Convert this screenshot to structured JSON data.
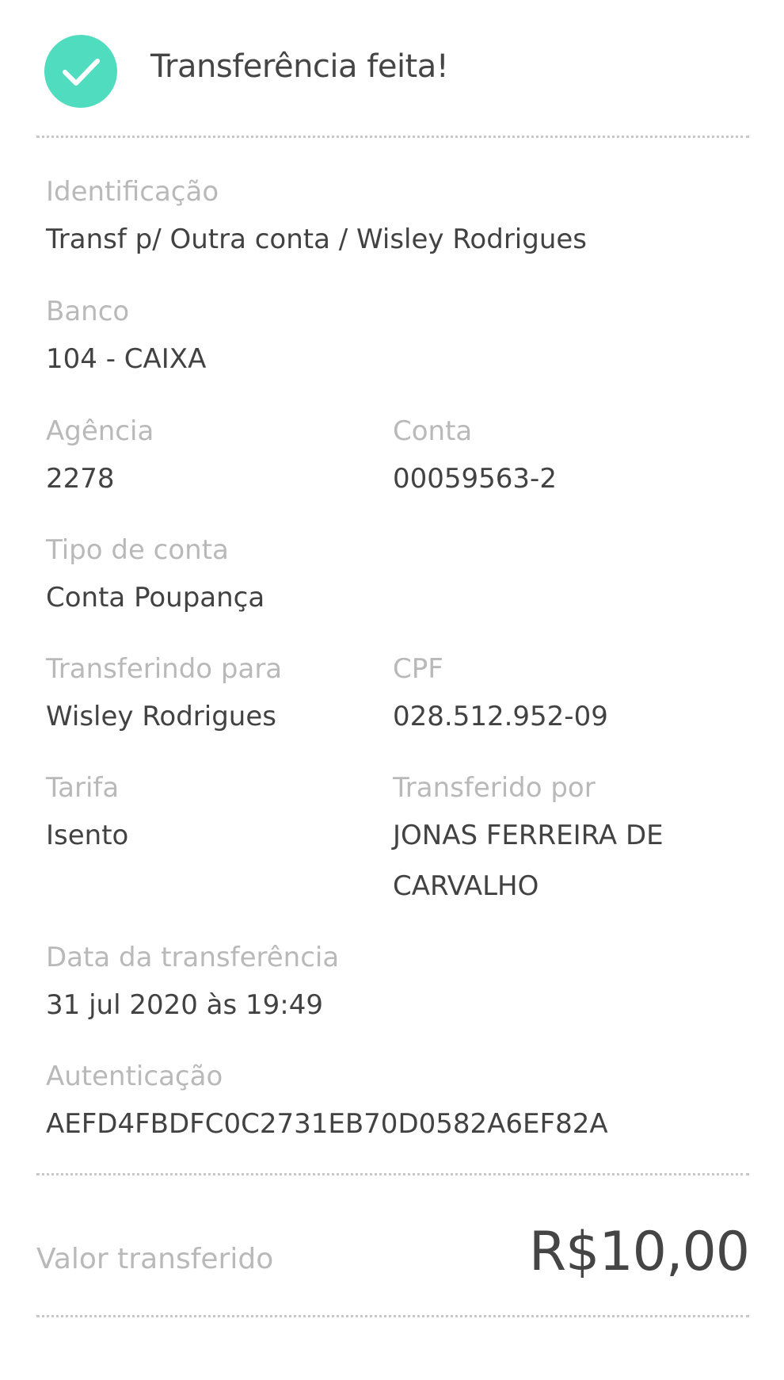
{
  "header": {
    "title": "Transferência feita!",
    "status_icon": "check-icon",
    "accent_color": "#4fdcbf"
  },
  "details": {
    "identificacao": {
      "label": "Identificação",
      "value": "Transf p/ Outra conta / Wisley Rodrigues"
    },
    "banco": {
      "label": "Banco",
      "value": "104 -  CAIXA"
    },
    "agencia": {
      "label": "Agência",
      "value": "2278"
    },
    "conta": {
      "label": "Conta",
      "value": "00059563-2"
    },
    "tipo_conta": {
      "label": "Tipo de conta",
      "value": "Conta Poupança"
    },
    "transferindo_para": {
      "label": "Transferindo para",
      "value": "Wisley Rodrigues"
    },
    "cpf": {
      "label": "CPF",
      "value": "028.512.952-09"
    },
    "tarifa": {
      "label": "Tarifa",
      "value": "Isento"
    },
    "transferido_por": {
      "label": "Transferido por",
      "value": "JONAS FERREIRA DE CARVALHO"
    },
    "data": {
      "label": "Data da transferência",
      "value": "31 jul 2020 às 19:49"
    },
    "autenticacao": {
      "label": "Autenticação",
      "value": "AEFD4FBDFC0C2731EB70D0582A6EF82A"
    }
  },
  "total": {
    "label": "Valor transferido",
    "value": "R$10,00"
  }
}
